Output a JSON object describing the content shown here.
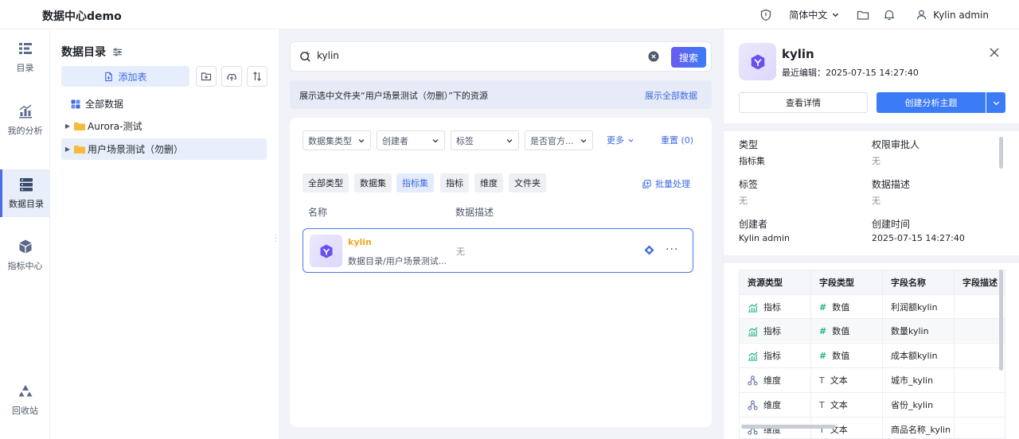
{
  "app": {
    "title": "数据中心demo"
  },
  "topbar": {
    "language": "简体中文",
    "user": "Kylin admin"
  },
  "nav": [
    {
      "label": "目录",
      "icon": "list-icon",
      "active": false
    },
    {
      "label": "我的分析",
      "icon": "chart-icon",
      "active": false
    },
    {
      "label": "数据目录",
      "icon": "database-icon",
      "active": true
    },
    {
      "label": "指标中心",
      "icon": "cube-icon",
      "active": false
    },
    {
      "label": "回收站",
      "icon": "recycle-icon",
      "active": false
    }
  ],
  "catalog": {
    "title": "数据目录",
    "add_table": "添加表",
    "tree": [
      {
        "label": "全部数据",
        "type": "all"
      },
      {
        "label": "Aurora-测试",
        "type": "folder"
      },
      {
        "label": "用户场景测试（勿删）",
        "type": "folder",
        "selected": true
      }
    ]
  },
  "search": {
    "value": "kylin",
    "button": "搜索"
  },
  "info": {
    "text": "展示选中文件夹“用户场景测试（勿删）”下的资源",
    "link": "展示全部数据"
  },
  "filters": [
    {
      "label": "数据集类型"
    },
    {
      "label": "创建者"
    },
    {
      "label": "标签"
    },
    {
      "label": "是否官方..."
    }
  ],
  "more": "更多",
  "reset": "重置 (0)",
  "chips": [
    {
      "label": "全部类型",
      "active": false
    },
    {
      "label": "数据集",
      "active": false
    },
    {
      "label": "指标集",
      "active": true
    },
    {
      "label": "指标",
      "active": false
    },
    {
      "label": "维度",
      "active": false
    },
    {
      "label": "文件夹",
      "active": false
    }
  ],
  "batch": "批量处理",
  "columns": {
    "name": "名称",
    "desc": "数据描述"
  },
  "result": {
    "name": "kylin",
    "path": "数据目录/用户场景测试...",
    "desc": "无"
  },
  "detail": {
    "name": "kylin",
    "last_edit": "最近编辑：2025-07-15 14:27:40",
    "view_button": "查看详情",
    "create_button": "创建分析主题",
    "props": [
      {
        "label": "类型",
        "value": "指标集"
      },
      {
        "label": "权限审批人",
        "value": "无"
      },
      {
        "label": "标签",
        "value": "无"
      },
      {
        "label": "数据描述",
        "value": "无"
      },
      {
        "label": "创建者",
        "value": "Kylin admin"
      },
      {
        "label": "创建时间",
        "value": "2025-07-15 14:27:40"
      }
    ],
    "field_headers": [
      "资源类型",
      "字段类型",
      "字段名称",
      "字段描述"
    ],
    "fields": [
      {
        "res_type": "指标",
        "field_type": "数值",
        "name": "利润额kylin",
        "desc": ""
      },
      {
        "res_type": "指标",
        "field_type": "数值",
        "name": "数量kylin",
        "desc": ""
      },
      {
        "res_type": "指标",
        "field_type": "数值",
        "name": "成本额kylin",
        "desc": ""
      },
      {
        "res_type": "维度",
        "field_type": "文本",
        "name": "城市_kylin",
        "desc": ""
      },
      {
        "res_type": "维度",
        "field_type": "文本",
        "name": "省份_kylin",
        "desc": ""
      },
      {
        "res_type": "维度",
        "field_type": "文本",
        "name": "商品名称_kylin",
        "desc": ""
      }
    ]
  },
  "colors": {
    "accent": "#3c7bf6",
    "active_bg": "#e9eefb",
    "brand_purple": "#6a5cf0",
    "name_orange": "#f5a623"
  }
}
